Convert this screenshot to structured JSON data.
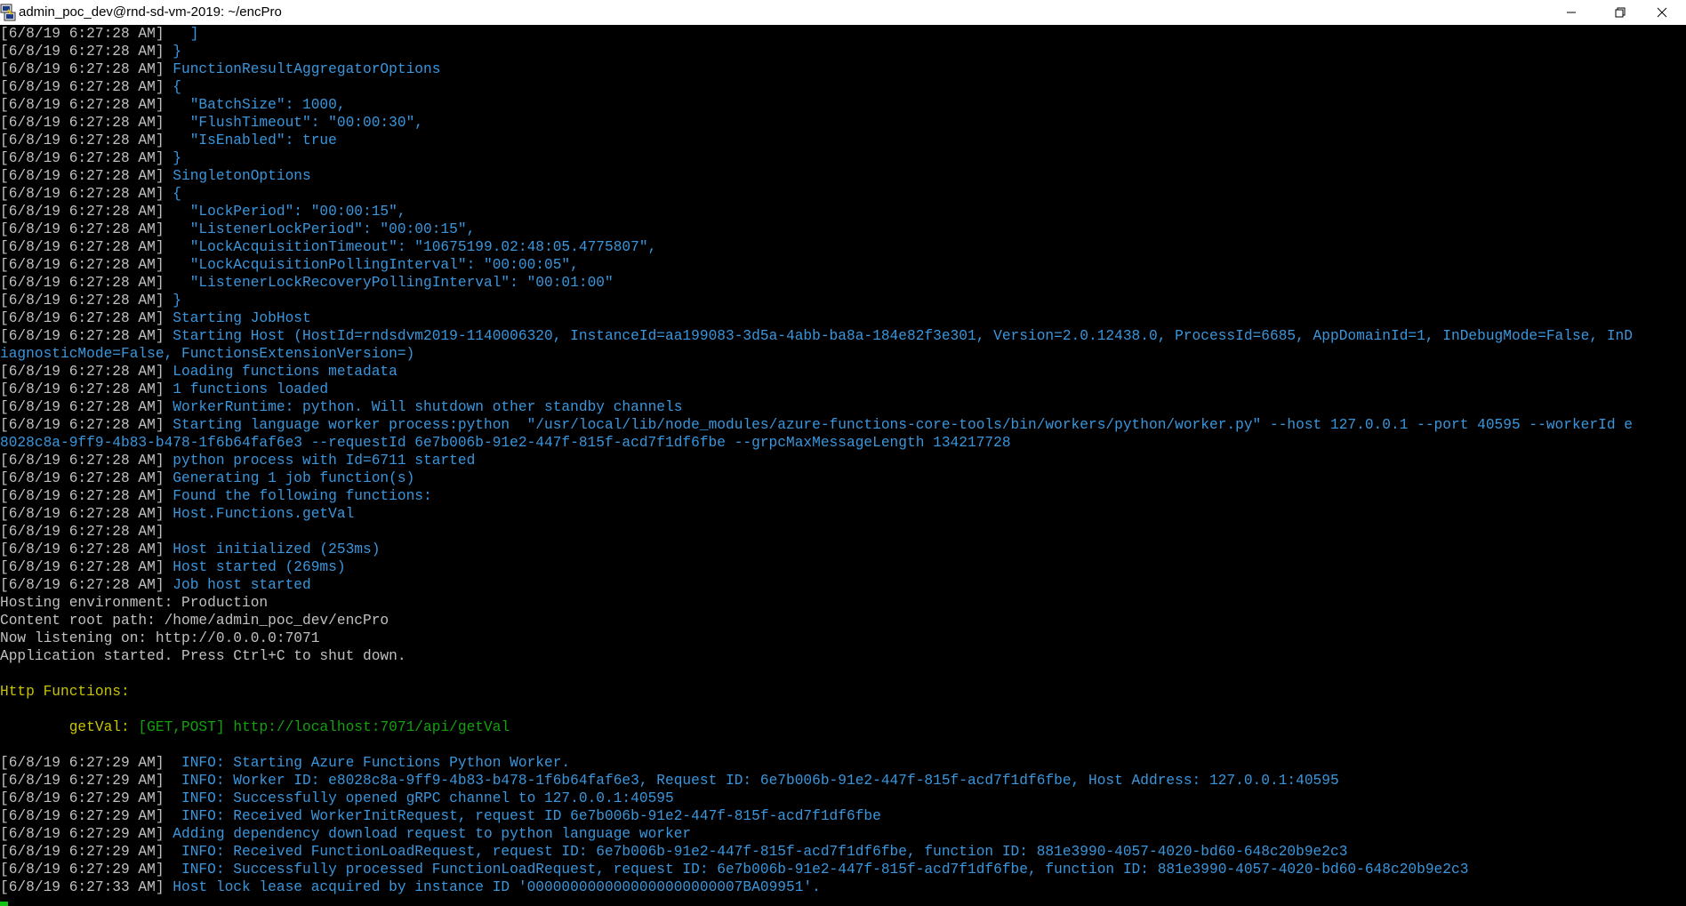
{
  "window": {
    "title": "admin_poc_dev@rnd-sd-vm-2019: ~/encPro",
    "icon": "putty-icon",
    "controls": [
      "minimize",
      "restore",
      "close"
    ]
  },
  "colors": {
    "background": "#000000",
    "timestamp": "#c0c0c0",
    "message": "#3a96dd",
    "heading": "#c8c400",
    "route": "#13a10e"
  },
  "lines": [
    {
      "ts": "[6/8/19 6:27:28 AM]",
      "msg": "   ]"
    },
    {
      "ts": "[6/8/19 6:27:28 AM]",
      "msg": " }"
    },
    {
      "ts": "[6/8/19 6:27:28 AM]",
      "msg": " FunctionResultAggregatorOptions"
    },
    {
      "ts": "[6/8/19 6:27:28 AM]",
      "msg": " {"
    },
    {
      "ts": "[6/8/19 6:27:28 AM]",
      "msg": "   \"BatchSize\": 1000,"
    },
    {
      "ts": "[6/8/19 6:27:28 AM]",
      "msg": "   \"FlushTimeout\": \"00:00:30\","
    },
    {
      "ts": "[6/8/19 6:27:28 AM]",
      "msg": "   \"IsEnabled\": true"
    },
    {
      "ts": "[6/8/19 6:27:28 AM]",
      "msg": " }"
    },
    {
      "ts": "[6/8/19 6:27:28 AM]",
      "msg": " SingletonOptions"
    },
    {
      "ts": "[6/8/19 6:27:28 AM]",
      "msg": " {"
    },
    {
      "ts": "[6/8/19 6:27:28 AM]",
      "msg": "   \"LockPeriod\": \"00:00:15\","
    },
    {
      "ts": "[6/8/19 6:27:28 AM]",
      "msg": "   \"ListenerLockPeriod\": \"00:00:15\","
    },
    {
      "ts": "[6/8/19 6:27:28 AM]",
      "msg": "   \"LockAcquisitionTimeout\": \"10675199.02:48:05.4775807\","
    },
    {
      "ts": "[6/8/19 6:27:28 AM]",
      "msg": "   \"LockAcquisitionPollingInterval\": \"00:00:05\","
    },
    {
      "ts": "[6/8/19 6:27:28 AM]",
      "msg": "   \"ListenerLockRecoveryPollingInterval\": \"00:01:00\""
    },
    {
      "ts": "[6/8/19 6:27:28 AM]",
      "msg": " }"
    },
    {
      "ts": "[6/8/19 6:27:28 AM]",
      "msg": " Starting JobHost"
    },
    {
      "ts": "[6/8/19 6:27:28 AM]",
      "msg": " Starting Host (HostId=rndsdvm2019-1140006320, InstanceId=aa199083-3d5a-4abb-ba8a-184e82f3e301, Version=2.0.12438.0, ProcessId=6685, AppDomainId=1, InDebugMode=False, InD"
    },
    {
      "ts": "",
      "msg": "iagnosticMode=False, FunctionsExtensionVersion=)"
    },
    {
      "ts": "[6/8/19 6:27:28 AM]",
      "msg": " Loading functions metadata"
    },
    {
      "ts": "[6/8/19 6:27:28 AM]",
      "msg": " 1 functions loaded"
    },
    {
      "ts": "[6/8/19 6:27:28 AM]",
      "msg": " WorkerRuntime: python. Will shutdown other standby channels"
    },
    {
      "ts": "[6/8/19 6:27:28 AM]",
      "msg": " Starting language worker process:python  \"/usr/local/lib/node_modules/azure-functions-core-tools/bin/workers/python/worker.py\" --host 127.0.0.1 --port 40595 --workerId e"
    },
    {
      "ts": "",
      "msg": "8028c8a-9ff9-4b83-b478-1f6b64faf6e3 --requestId 6e7b006b-91e2-447f-815f-acd7f1df6fbe --grpcMaxMessageLength 134217728"
    },
    {
      "ts": "[6/8/19 6:27:28 AM]",
      "msg": " python process with Id=6711 started"
    },
    {
      "ts": "[6/8/19 6:27:28 AM]",
      "msg": " Generating 1 job function(s)"
    },
    {
      "ts": "[6/8/19 6:27:28 AM]",
      "msg": " Found the following functions:"
    },
    {
      "ts": "[6/8/19 6:27:28 AM]",
      "msg": " Host.Functions.getVal"
    },
    {
      "ts": "[6/8/19 6:27:28 AM]",
      "msg": ""
    },
    {
      "ts": "[6/8/19 6:27:28 AM]",
      "msg": " Host initialized (253ms)"
    },
    {
      "ts": "[6/8/19 6:27:28 AM]",
      "msg": " Host started (269ms)"
    },
    {
      "ts": "[6/8/19 6:27:28 AM]",
      "msg": " Job host started"
    }
  ],
  "hosting": [
    "Hosting environment: Production",
    "Content root path: /home/admin_poc_dev/encPro",
    "Now listening on: http://0.0.0.0:7071",
    "Application started. Press Ctrl+C to shut down."
  ],
  "http_functions": {
    "heading": "Http Functions:",
    "name": "getVal:",
    "methods": "[GET,POST]",
    "url": "http://localhost:7071/api/getVal"
  },
  "worker_lines": [
    {
      "ts": "[6/8/19 6:27:29 AM]",
      "msg": "  INFO: Starting Azure Functions Python Worker."
    },
    {
      "ts": "[6/8/19 6:27:29 AM]",
      "msg": "  INFO: Worker ID: e8028c8a-9ff9-4b83-b478-1f6b64faf6e3, Request ID: 6e7b006b-91e2-447f-815f-acd7f1df6fbe, Host Address: 127.0.0.1:40595"
    },
    {
      "ts": "[6/8/19 6:27:29 AM]",
      "msg": "  INFO: Successfully opened gRPC channel to 127.0.0.1:40595"
    },
    {
      "ts": "[6/8/19 6:27:29 AM]",
      "msg": "  INFO: Received WorkerInitRequest, request ID 6e7b006b-91e2-447f-815f-acd7f1df6fbe"
    },
    {
      "ts": "[6/8/19 6:27:29 AM]",
      "msg": " Adding dependency download request to python language worker"
    },
    {
      "ts": "[6/8/19 6:27:29 AM]",
      "msg": "  INFO: Received FunctionLoadRequest, request ID: 6e7b006b-91e2-447f-815f-acd7f1df6fbe, function ID: 881e3990-4057-4020-bd60-648c20b9e2c3"
    },
    {
      "ts": "[6/8/19 6:27:29 AM]",
      "msg": "  INFO: Successfully processed FunctionLoadRequest, request ID: 6e7b006b-91e2-447f-815f-acd7f1df6fbe, function ID: 881e3990-4057-4020-bd60-648c20b9e2c3"
    },
    {
      "ts": "[6/8/19 6:27:33 AM]",
      "msg": " Host lock lease acquired by instance ID '0000000000000000000000007BA09951'."
    }
  ]
}
